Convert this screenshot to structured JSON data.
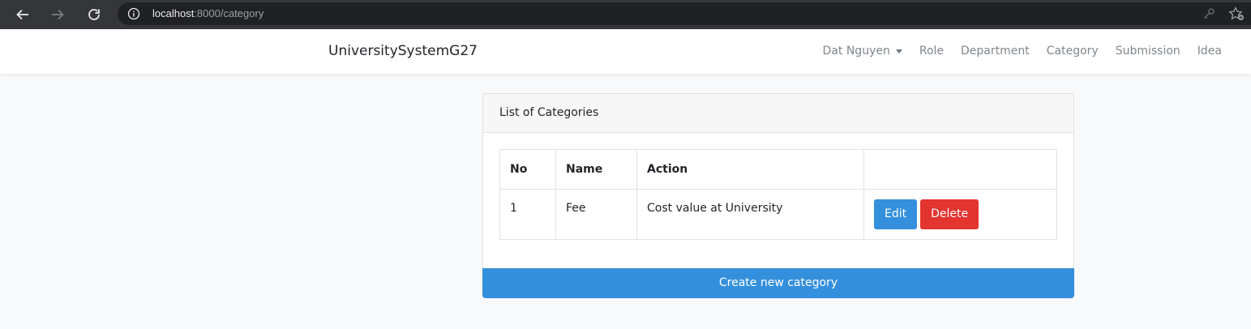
{
  "browser": {
    "url_host": "localhost",
    "url_path": ":8000/category"
  },
  "navbar": {
    "brand": "UniversitySystemG27",
    "user": "Dat Nguyen",
    "links": [
      "Role",
      "Department",
      "Category",
      "Submission",
      "Idea"
    ]
  },
  "card": {
    "header": "List of Categories",
    "table": {
      "columns": [
        "No",
        "Name",
        "Action",
        ""
      ],
      "rows": [
        {
          "no": "1",
          "name": "Fee",
          "action": "Cost value at University"
        }
      ]
    },
    "edit_label": "Edit",
    "delete_label": "Delete",
    "create_label": "Create new category"
  },
  "colors": {
    "primary": "#3490dc",
    "danger": "#e3342f",
    "chrome": "#35363a"
  }
}
